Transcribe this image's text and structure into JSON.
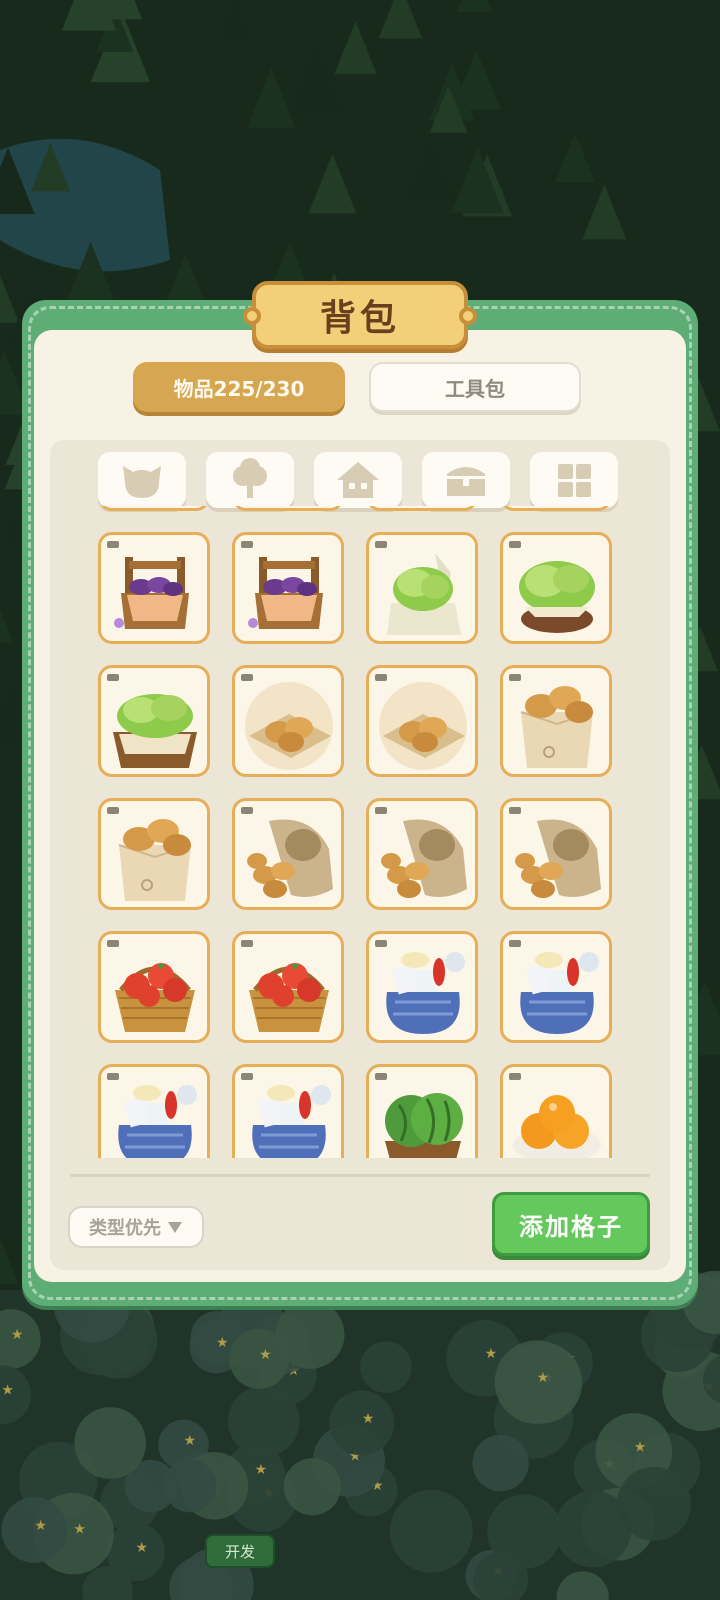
{
  "panel": {
    "title": "背包"
  },
  "tabs": [
    {
      "label": "物品225/230",
      "active": true
    },
    {
      "label": "工具包",
      "active": false
    }
  ],
  "filters": [
    {
      "icon": "pet-icon"
    },
    {
      "icon": "tree-icon"
    },
    {
      "icon": "house-icon"
    },
    {
      "icon": "chest-icon"
    },
    {
      "icon": "grid-icon"
    }
  ],
  "items": [
    [
      "eggplant-crate",
      "eggplant-crate",
      "lettuce-bag",
      "lettuce-bowl"
    ],
    [
      "lettuce-crate",
      "potato-plate",
      "potato-plate",
      "potato-box"
    ],
    [
      "potato-box",
      "potato-sack",
      "potato-sack",
      "potato-sack"
    ],
    [
      "tomato-basket",
      "tomato-basket",
      "grocery-bag",
      "grocery-bag"
    ],
    [
      "grocery-bag",
      "grocery-bag",
      "watermelon-basket",
      "orange-plate"
    ]
  ],
  "footer": {
    "sort_label": "类型优先",
    "add_label": "添加格子"
  },
  "dev_button": "开发",
  "colors": {
    "panel_green": "#5fad76",
    "accent_gold": "#d7a650",
    "add_green": "#65c85c"
  }
}
